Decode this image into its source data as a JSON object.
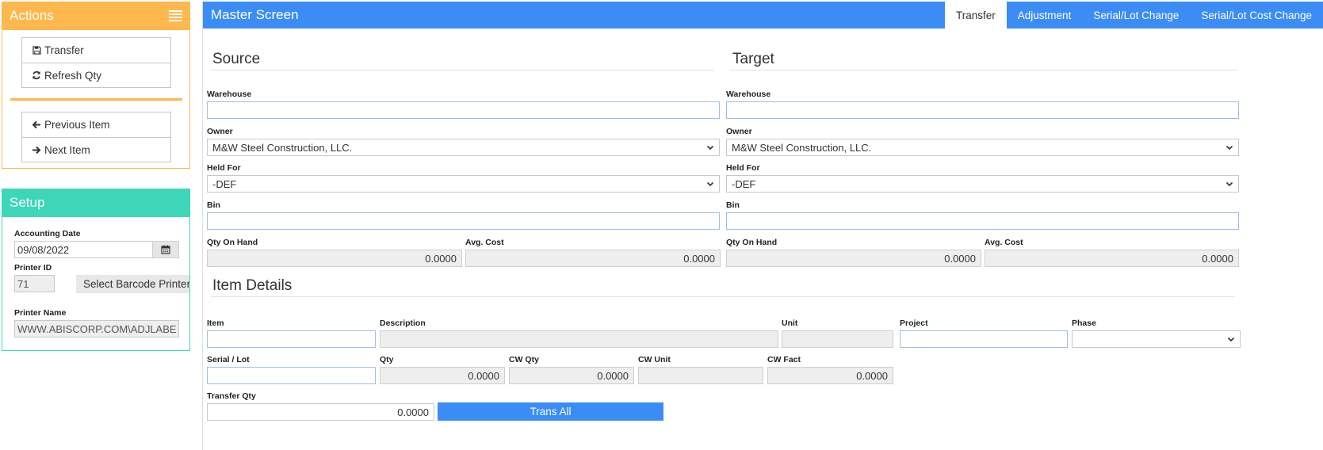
{
  "actions": {
    "title": "Actions",
    "group1": [
      {
        "label": "Transfer",
        "icon": "save-icon"
      },
      {
        "label": "Refresh Qty",
        "icon": "refresh-icon"
      }
    ],
    "group2": [
      {
        "label": "Previous Item",
        "icon": "arrow-left-icon"
      },
      {
        "label": "Next Item",
        "icon": "arrow-right-icon"
      }
    ]
  },
  "setup": {
    "title": "Setup",
    "accounting_date_label": "Accounting Date",
    "accounting_date": "09/08/2022",
    "printer_id_label": "Printer ID",
    "printer_id": "71",
    "select_printer_label": "Select Barcode Printer",
    "printer_name_label": "Printer Name",
    "printer_name": "WWW.ABISCORP.COM\\ADJLABEL"
  },
  "master": {
    "title": "Master Screen",
    "tabs": [
      {
        "label": "Transfer",
        "active": true
      },
      {
        "label": "Adjustment",
        "active": false
      },
      {
        "label": "Serial/Lot Change",
        "active": false
      },
      {
        "label": "Serial/Lot Cost Change",
        "active": false
      }
    ],
    "source": {
      "title": "Source",
      "warehouse_label": "Warehouse",
      "warehouse": "",
      "owner_label": "Owner",
      "owner": "M&W Steel Construction, LLC.",
      "held_for_label": "Held For",
      "held_for": "-DEF",
      "bin_label": "Bin",
      "bin": "",
      "qty_on_hand_label": "Qty On Hand",
      "qty_on_hand": "0.0000",
      "avg_cost_label": "Avg. Cost",
      "avg_cost": "0.0000"
    },
    "target": {
      "title": "Target",
      "warehouse_label": "Warehouse",
      "warehouse": "",
      "owner_label": "Owner",
      "owner": "M&W Steel Construction, LLC.",
      "held_for_label": "Held For",
      "held_for": "-DEF",
      "bin_label": "Bin",
      "bin": "",
      "qty_on_hand_label": "Qty On Hand",
      "qty_on_hand": "0.0000",
      "avg_cost_label": "Avg. Cost",
      "avg_cost": "0.0000"
    },
    "item_details": {
      "title": "Item Details",
      "item_label": "Item",
      "item": "",
      "description_label": "Description",
      "description": "",
      "unit_label": "Unit",
      "unit": "",
      "project_label": "Project",
      "project": "",
      "phase_label": "Phase",
      "phase": "",
      "serial_lot_label": "Serial / Lot",
      "serial_lot": "",
      "qty_label": "Qty",
      "qty": "0.0000",
      "cw_qty_label": "CW Qty",
      "cw_qty": "0.0000",
      "cw_unit_label": "CW Unit",
      "cw_unit": "",
      "cw_fact_label": "CW Fact",
      "cw_fact": "0.0000",
      "transfer_qty_label": "Transfer Qty",
      "transfer_qty": "0.0000",
      "trans_all_label": "Trans All"
    }
  }
}
